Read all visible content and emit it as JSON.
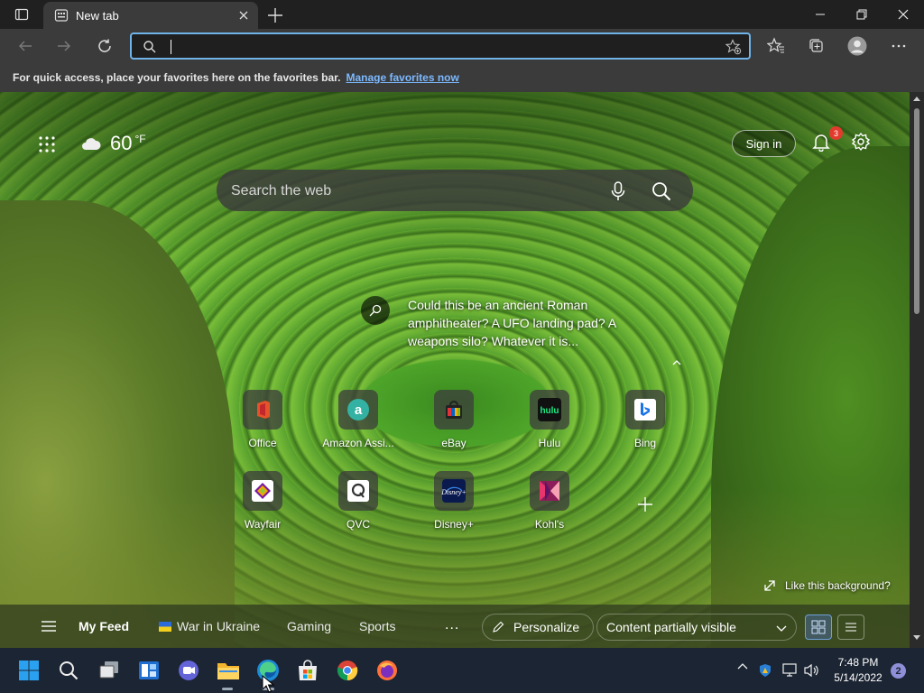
{
  "browser": {
    "tab": {
      "title": "New tab"
    },
    "address_bar": {
      "value": "",
      "placeholder": ""
    },
    "favorites_bar": {
      "message": "For quick access, place your favorites here on the favorites bar.",
      "link": "Manage favorites now"
    }
  },
  "new_tab_page": {
    "weather": {
      "temperature": "60",
      "unit": "°F",
      "condition_icon": "cloud-icon"
    },
    "sign_in_label": "Sign in",
    "notification_count": "3",
    "search": {
      "placeholder": "Search the web"
    },
    "background_caption": "Could this be an ancient Roman amphitheater? A UFO landing pad? A weapons silo? Whatever it is...",
    "quick_links": [
      {
        "label": "Office",
        "icon": "office-icon"
      },
      {
        "label": "Amazon Assi...",
        "icon": "amazon-icon"
      },
      {
        "label": "eBay",
        "icon": "ebay-icon"
      },
      {
        "label": "Hulu",
        "icon": "hulu-icon"
      },
      {
        "label": "Bing",
        "icon": "bing-icon"
      },
      {
        "label": "Wayfair",
        "icon": "wayfair-icon"
      },
      {
        "label": "QVC",
        "icon": "qvc-icon"
      },
      {
        "label": "Disney+",
        "icon": "disney-icon"
      },
      {
        "label": "Kohl's",
        "icon": "kohls-icon"
      }
    ],
    "like_background": "Like this background?",
    "feed": {
      "items": [
        "My Feed",
        "War in Ukraine",
        "Gaming",
        "Sports"
      ],
      "more": "...",
      "personalize": "Personalize",
      "content_visibility": "Content partially visible"
    }
  },
  "taskbar": {
    "apps": [
      "start-icon",
      "search-icon",
      "task-view-icon",
      "widgets-icon",
      "teams-chat-icon",
      "file-explorer-icon",
      "edge-icon",
      "microsoft-store-icon",
      "chrome-icon",
      "firefox-icon"
    ],
    "clock": {
      "time": "7:48 PM",
      "date": "5/14/2022"
    },
    "notification_count": "2"
  },
  "colors": {
    "accent": "#6fb3e8",
    "link": "#7cb9ff",
    "badge": "#e23b2d",
    "taskbar": "#1c2533"
  }
}
